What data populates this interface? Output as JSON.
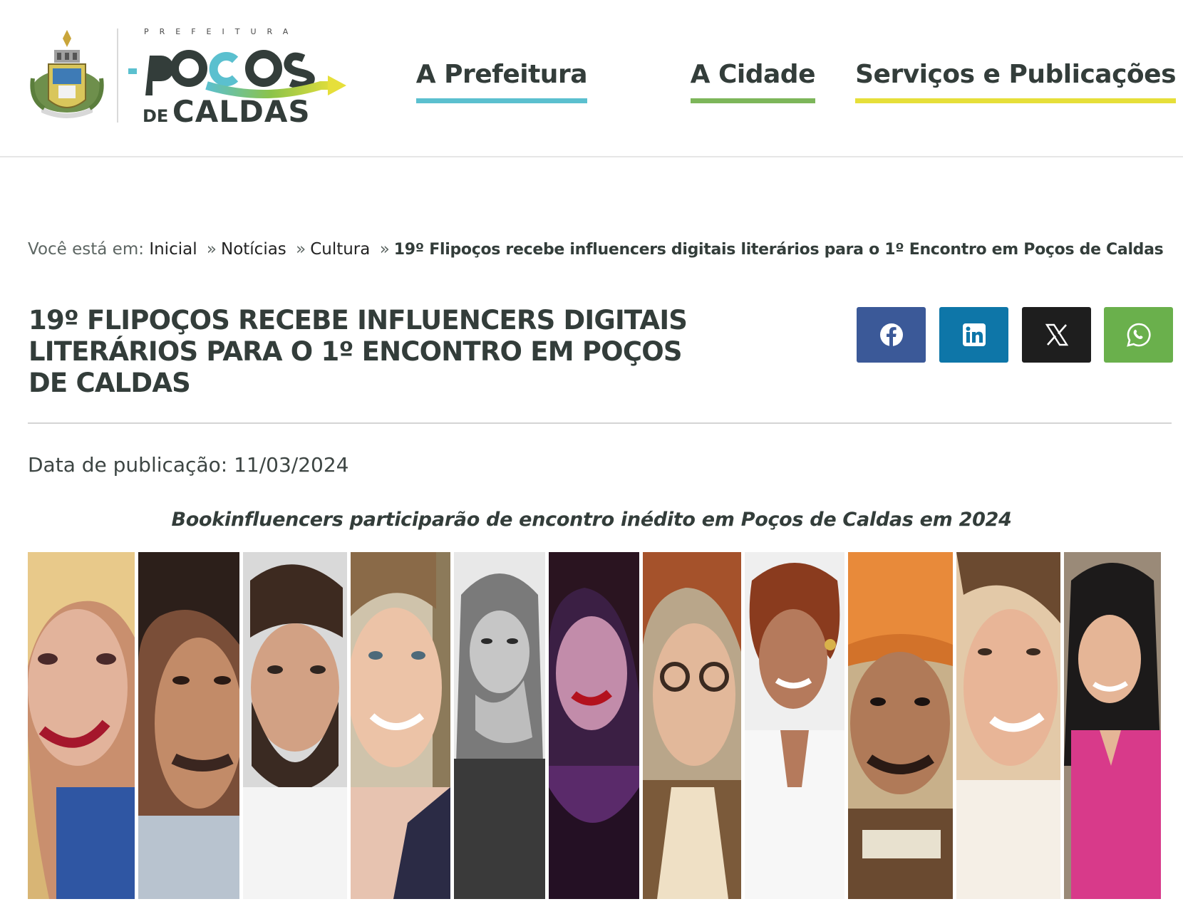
{
  "header": {
    "logo": {
      "prefix": "PREFEITURA",
      "name": "poços",
      "de": "DE",
      "city": "CALDAS"
    },
    "nav": [
      {
        "label": "A Prefeitura",
        "color": "#5bc0cf"
      },
      {
        "label": "A Cidade",
        "color": "#7db65a"
      },
      {
        "label": "Serviços e Publicações",
        "color": "#e6df3a"
      }
    ]
  },
  "breadcrumb": {
    "prefix": "Você está em:",
    "items": [
      "Inicial",
      "Notícias",
      "Cultura"
    ],
    "separator": "»",
    "current": "19º Flipoços recebe influencers digitais literários para o 1º Encontro em Poços de Caldas"
  },
  "article": {
    "title": "19º FLIPOÇOS RECEBE INFLUENCERS DIGITAIS LITERÁRIOS PARA O 1º ENCONTRO EM POÇOS DE CALDAS",
    "pubdate": "Data de publicação: 11/03/2024",
    "caption": "Bookinfluencers participarão de encontro inédito em Poços de Caldas em 2024"
  },
  "share": [
    {
      "name": "facebook",
      "icon": "facebook-icon",
      "color": "#3b5998"
    },
    {
      "name": "linkedin",
      "icon": "linkedin-icon",
      "color": "#0e76a8"
    },
    {
      "name": "x",
      "icon": "x-icon",
      "color": "#1e1e1e"
    },
    {
      "name": "whatsapp",
      "icon": "whatsapp-icon",
      "color": "#6ab04c"
    }
  ],
  "colors": {
    "text": "#333d3a",
    "accent_teal": "#5bc0cf",
    "accent_green": "#7db65a",
    "accent_yellow": "#e6df3a"
  }
}
